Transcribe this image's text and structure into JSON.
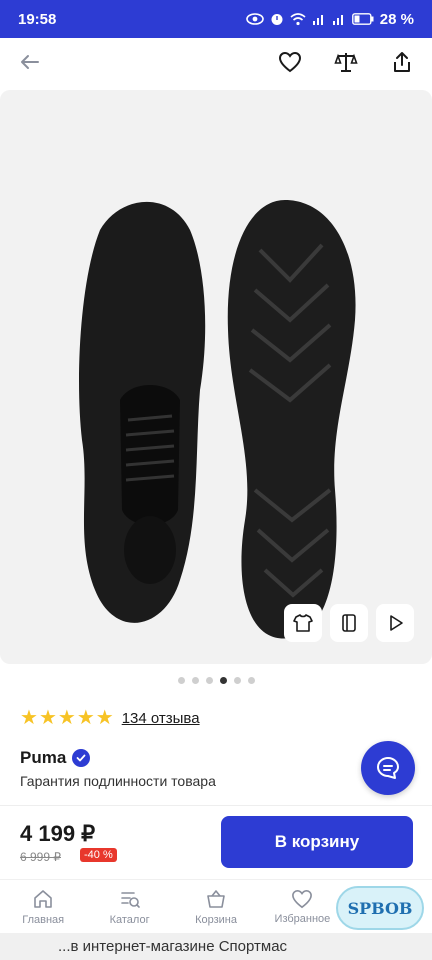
{
  "status_bar": {
    "time": "19:58",
    "battery": "28 %"
  },
  "gallery": {
    "dots_count": 6,
    "active_dot": 3
  },
  "rating": {
    "stars": 5,
    "reviews_label": "134 отзыва"
  },
  "product": {
    "brand": "Puma",
    "guarantee": "Гарантия подлинности товара",
    "price": "4 199 ₽",
    "old_price": "6 999 ₽",
    "discount": "-40 %"
  },
  "cart_button": "В корзину",
  "tabs": [
    {
      "label": "Главная",
      "icon": "home-icon"
    },
    {
      "label": "Каталог",
      "icon": "catalog-icon"
    },
    {
      "label": "Корзина",
      "icon": "basket-icon"
    },
    {
      "label": "Избранное",
      "icon": "heart-icon"
    }
  ],
  "footer_note": "...в интернет-магазине Спортмас",
  "watermark": "SPBOB",
  "colors": {
    "accent": "#2d3cd3",
    "discount": "#e8372c",
    "star": "#f7c325"
  }
}
